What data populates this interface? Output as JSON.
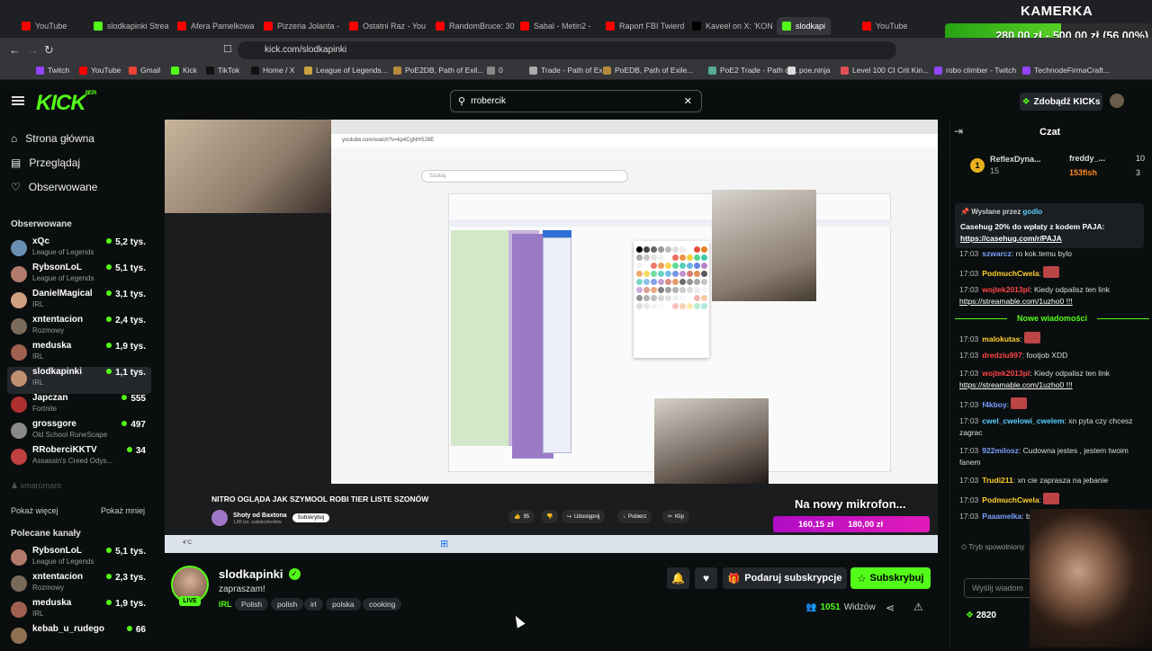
{
  "overlay": {
    "kamerka": "KAMERKA",
    "goal": {
      "current": "280,00 zł",
      "sep": "-",
      "target": "500,00 zł",
      "percent": "(56.00%)",
      "progress": 0.56
    }
  },
  "browser": {
    "tabs": [
      {
        "label": "YouTube",
        "color": "#ff0000"
      },
      {
        "label": "slodkapinki Strea",
        "color": "#53fc18"
      },
      {
        "label": "Afera Pamelkowa",
        "color": "#ff0000"
      },
      {
        "label": "Pizzeria Jolanta -",
        "color": "#ff0000"
      },
      {
        "label": "Ostatni Raz - You",
        "color": "#ff0000"
      },
      {
        "label": "RandomBruce: 30",
        "color": "#ff0000"
      },
      {
        "label": "Sabal - Metin2 -",
        "color": "#ff0000"
      },
      {
        "label": "Raport FBI Twierd",
        "color": "#ff0000"
      },
      {
        "label": "Kaveel on X: 'KON",
        "color": "#000000"
      },
      {
        "label": "slodkapi",
        "color": "#53fc18"
      },
      {
        "label": "YouTube",
        "color": "#ff0000"
      }
    ],
    "url": "kick.com/slodkapinki",
    "bookmarks": [
      "Twitch",
      "YouTube",
      "Gmail",
      "Kick",
      "TikTok",
      "Home / X",
      "League of Legends...",
      "PoE2DB, Path of Exil...",
      "0",
      "Trade - Path of Exile",
      "PoEDB, Path of Exile...",
      "PoE2 Trade - Path of...",
      "poe.ninja",
      "Level 100 CI Crit Kin...",
      "robo climber - Twitch",
      "TechnodeFirmaCraft..."
    ]
  },
  "header": {
    "logo": "KICK",
    "logo_sup": "BETA",
    "search_value": "rrobercik",
    "get_kicks": "Zdobądź KICKs"
  },
  "sidebar": {
    "nav": [
      "Strona główna",
      "Przeglądaj",
      "Obserwowane"
    ],
    "followed_heading": "Obserwowane",
    "followed": [
      {
        "name": "xQc",
        "cat": "League of Legends",
        "viewers": "5,2 tys.",
        "color": "#6b8fb3"
      },
      {
        "name": "RybsonLoL",
        "cat": "League of Legends",
        "viewers": "5,1 tys.",
        "color": "#b37b6b"
      },
      {
        "name": "DanielMagical",
        "cat": "IRL",
        "viewers": "3,1 tys.",
        "color": "#d0a080"
      },
      {
        "name": "xntentacion",
        "cat": "Rozmowy",
        "viewers": "2,4 tys.",
        "color": "#7a6a5a"
      },
      {
        "name": "meduska",
        "cat": "IRL",
        "viewers": "1,9 tys.",
        "color": "#a06050"
      },
      {
        "name": "slodkapinki",
        "cat": "IRL",
        "viewers": "1,1 tys.",
        "color": "#c09070"
      },
      {
        "name": "Japczan",
        "cat": "Fortnite",
        "viewers": "555",
        "color": "#b03030"
      },
      {
        "name": "grossgore",
        "cat": "Old School RuneScape",
        "viewers": "497",
        "color": "#8a8a8a"
      },
      {
        "name": "RRoberciKKTV",
        "cat": "Assassin's Creed Odys...",
        "viewers": "34",
        "color": "#c04040"
      }
    ],
    "offline": "xmaromaro",
    "show_more": "Pokaż więcej",
    "show_less": "Pokaż mniej",
    "recommended_heading": "Polecane kanały",
    "recommended": [
      {
        "name": "RybsonLoL",
        "cat": "League of Legends",
        "viewers": "5,1 tys.",
        "color": "#b37b6b"
      },
      {
        "name": "xntentacion",
        "cat": "Rozmowy",
        "viewers": "2,3 tys.",
        "color": "#7a6a5a"
      },
      {
        "name": "meduska",
        "cat": "IRL",
        "viewers": "1,9 tys.",
        "color": "#a06050"
      },
      {
        "name": "kebab_u_rudego",
        "cat": "",
        "viewers": "66",
        "color": "#907050"
      }
    ]
  },
  "player": {
    "yt_url": "youtube.com/watch?v=kp4CgNHS28E",
    "yt_search": "Szukaj",
    "video_title": "NITRO OGLĄDA JAK SZYMOOL ROBI TIER LISTE SZONÓW",
    "channel": "Shoty od Baxtona",
    "channel_subs": "1,86 tys. subskrybentów",
    "subscribe": "Subskrybuj",
    "likes": "95",
    "share": "Udostępnij",
    "download": "Pobierz",
    "clip": "Klip",
    "mic_text": "Na nowy mikrofon...",
    "donation_current": "160,15 zł",
    "donation_target": "180,00 zł",
    "weather": "4°C"
  },
  "streamer": {
    "name": "slodkapinki",
    "title": "zapraszam!",
    "category": "IRL",
    "tags": [
      "Polish",
      "polish",
      "irl",
      "polska",
      "cooking"
    ],
    "live": "LIVE",
    "gift_btn": "Podaruj subskrypcje",
    "sub_btn": "Subskrybuj",
    "viewers_count": "1051",
    "viewers_label": "Widzów"
  },
  "chat": {
    "title": "Czat",
    "leaderboard": [
      {
        "name": "ReflexDyna...",
        "value": "15",
        "rank": "1"
      },
      {
        "name": "freddy_...",
        "value": "10"
      },
      {
        "name": "153fish",
        "value": "3"
      }
    ],
    "pinned_by": "Wysłane przez",
    "pinned_user": "godlo",
    "pinned_msg": "Casehug 20% do wpłaty z kodem PAJA:",
    "pinned_link": "https://casehug.com/r/PAJA",
    "new_messages": "Nowe wiadomości",
    "messages_top": [
      {
        "time": "17:03",
        "user": "szwarcz",
        "ucolor": "#7aa0ff",
        "text": "ro kok.temu bylo"
      },
      {
        "time": "17:03",
        "user": "PodmuchCwela",
        "ucolor": "#ffd02b",
        "text": "",
        "emote": true
      },
      {
        "time": "17:03",
        "user": "wojtek2013pl",
        "ucolor": "#ff4646",
        "text": "Kiedy odpalisz ten link",
        "link": "https://streamable.com/1uzho0 !!!"
      }
    ],
    "messages_new": [
      {
        "time": "17:03",
        "user": "malokutas",
        "ucolor": "#ffd02b",
        "text": "",
        "emote": true
      },
      {
        "time": "17:03",
        "user": "dredziu997",
        "ucolor": "#ff4646",
        "text": "footjob XDD"
      },
      {
        "time": "17:03",
        "user": "wojtek2013pl",
        "ucolor": "#ff4646",
        "text": "Kiedy odpalisz ten link",
        "link": "https://streamable.com/1uzho0 !!!"
      },
      {
        "time": "17:03",
        "user": "f4kboy",
        "ucolor": "#7aa0ff",
        "text": "",
        "emote": true
      },
      {
        "time": "17:03",
        "user": "cwel_cwelowi_cwelem",
        "ucolor": "#5ad0ff",
        "text": "xn pyta czy chcesz zagrac"
      },
      {
        "time": "17:03",
        "user": "922milosz",
        "ucolor": "#7aa0ff",
        "text": "Cudowna jestes , jestem twoim fanem"
      },
      {
        "time": "17:03",
        "user": "Trudi211",
        "ucolor": "#ffd02b",
        "text": "xn cie zaprasza na jebanie"
      },
      {
        "time": "17:03",
        "user": "PodmuchCwela",
        "ucolor": "#ffd02b",
        "text": "",
        "emote": true
      },
      {
        "time": "17:03",
        "user": "Paaamelka",
        "ucolor": "#7aa0ff",
        "text": "bro będziesz wygladac"
      }
    ],
    "slow_mode": "Tryb spowolniony",
    "input_placeholder": "Wyślij wiadom",
    "kicks": "2820"
  }
}
